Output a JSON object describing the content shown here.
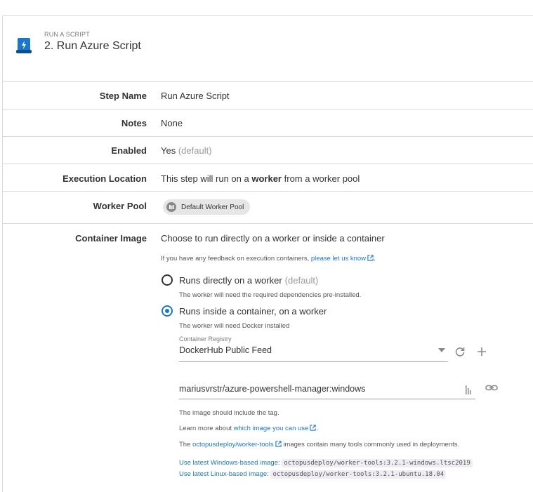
{
  "header": {
    "kicker": "RUN A SCRIPT",
    "title": "2.  Run Azure Script"
  },
  "rows": {
    "step_name": {
      "label": "Step Name",
      "value": "Run Azure Script"
    },
    "notes": {
      "label": "Notes",
      "value": "None"
    },
    "enabled": {
      "label": "Enabled",
      "value": "Yes",
      "suffix": "(default)"
    },
    "execution_location": {
      "label": "Execution Location",
      "prefix": "This step will run on a",
      "emphasis": "worker",
      "suffix": "from a worker pool"
    },
    "worker_pool": {
      "label": "Worker Pool",
      "chip": "Default Worker Pool"
    },
    "container_image": {
      "label": "Container Image",
      "intro": "Choose to run directly on a worker or inside a container",
      "feedback_prefix": "If you have any feedback on execution containers,",
      "feedback_link": "please let us know",
      "feedback_suffix": ".",
      "option_direct": {
        "label": "Runs directly on a worker",
        "suffix": "(default)",
        "hint": "The worker will need the required dependencies pre-installed."
      },
      "option_container": {
        "label": "Runs inside a container, on a worker",
        "hint": "The worker will need Docker installed"
      },
      "registry_label": "Container Registry",
      "registry_value": "DockerHub Public Feed",
      "image_value": "mariusvrstr/azure-powershell-manager:windows",
      "tag_hint": "The image should include the tag.",
      "learn_prefix": "Learn more about",
      "learn_link": "which image you can use",
      "learn_suffix": ".",
      "tools_prefix": "The",
      "tools_link": "octopusdeploy/worker-tools",
      "tools_suffix": "images contain many tools commonly used in deployments.",
      "windows_link": "Use latest Windows-based image:",
      "windows_image": "octopusdeploy/worker-tools:3.2.1-windows.ltsc2019",
      "linux_link": "Use latest Linux-based image:",
      "linux_image": "octopusdeploy/worker-tools:3.2.1-ubuntu.18.04"
    }
  },
  "colors": {
    "accent": "#1a77ca",
    "border": "#d9d9d9",
    "logo": "#1a77ca",
    "chip_bg": "#e6e6e6"
  },
  "icons": [
    "script-logo-icon",
    "worker-pool-icon",
    "external-link-icon",
    "dropdown-arrow-icon",
    "refresh-icon",
    "add-icon",
    "image-picker-icon",
    "link-icon"
  ]
}
